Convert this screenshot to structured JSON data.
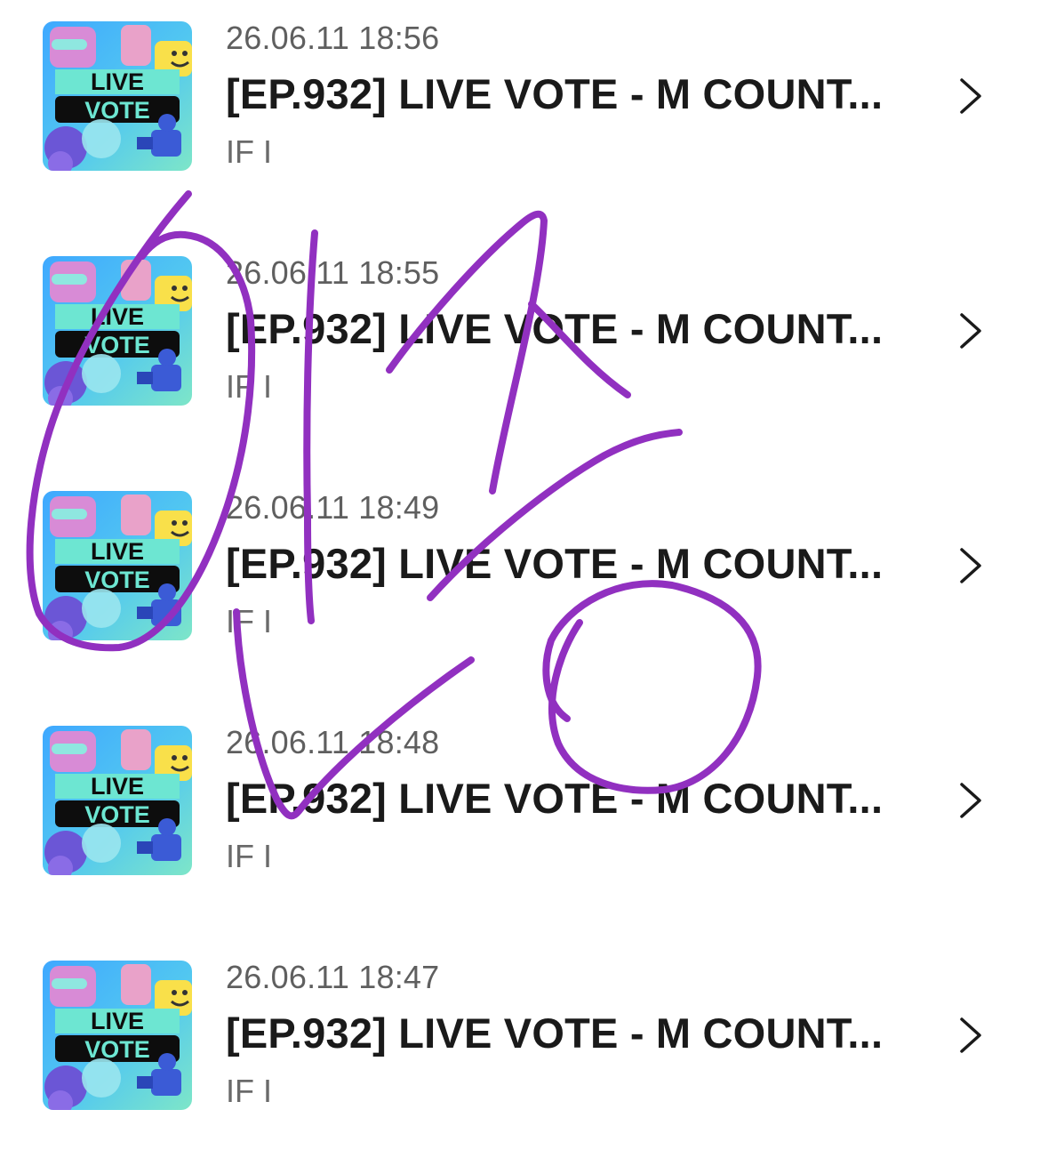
{
  "list": {
    "items": [
      {
        "timestamp": "26.06.11 18:56",
        "title": "[EP.932] LIVE VOTE - M COUNT...",
        "subtitle": "IF I",
        "thumb_line1": "LIVE",
        "thumb_line2": "VOTE"
      },
      {
        "timestamp": "26.06.11 18:55",
        "title": "[EP.932] LIVE VOTE - M COUNT...",
        "subtitle": "IF I",
        "thumb_line1": "LIVE",
        "thumb_line2": "VOTE"
      },
      {
        "timestamp": "26.06.11 18:49",
        "title": "[EP.932] LIVE VOTE - M COUNT...",
        "subtitle": "IF I",
        "thumb_line1": "LIVE",
        "thumb_line2": "VOTE"
      },
      {
        "timestamp": "26.06.11 18:48",
        "title": "[EP.932] LIVE VOTE - M COUNT...",
        "subtitle": "IF I",
        "thumb_line1": "LIVE",
        "thumb_line2": "VOTE"
      },
      {
        "timestamp": "26.06.11 18:47",
        "title": "[EP.932] LIVE VOTE - M COUNT...",
        "subtitle": "IF I",
        "thumb_line1": "LIVE",
        "thumb_line2": "VOTE"
      }
    ],
    "chevron_icon": "chevron-right-icon"
  },
  "colors": {
    "annotation_stroke": "#9130c0",
    "timestamp_text": "#5f5f5f",
    "title_text": "#1a1a1a",
    "subtitle_text": "#6a6a6a",
    "thumb_banner": "#6de6d2",
    "thumb_label_bg": "#0d0d0d"
  }
}
